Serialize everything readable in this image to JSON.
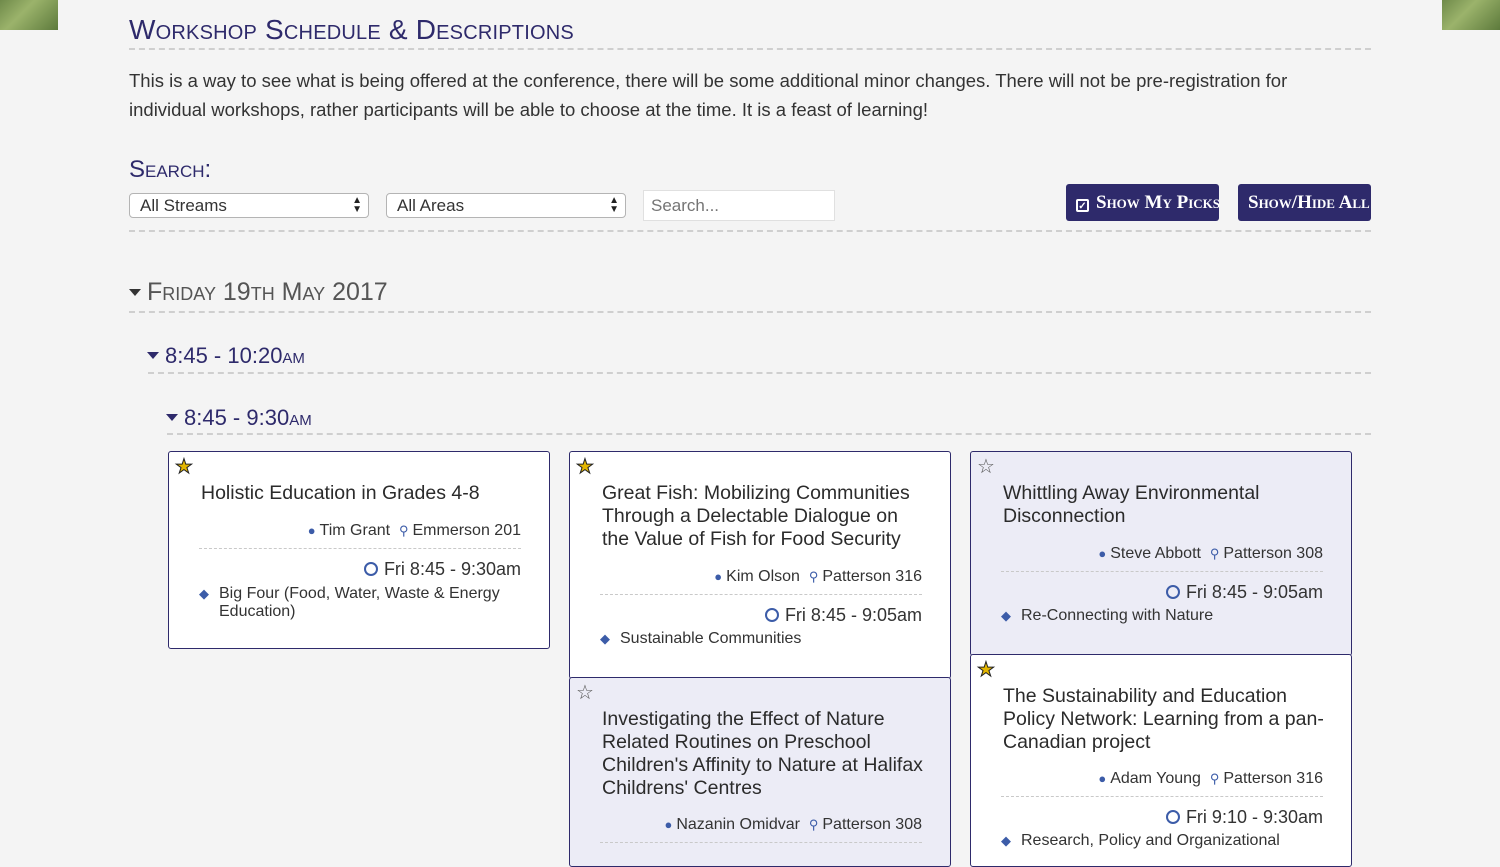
{
  "page": {
    "title": "Workshop Schedule & Descriptions",
    "intro": "This is a way to see what is being offered at the conference, there will be some additional minor changes. There will not be pre-registration for individual workshops, rather participants will be able to choose at the time. It is a feast of learning!"
  },
  "search": {
    "label": "Search:",
    "streams_selected": "All Streams",
    "areas_selected": "All Areas",
    "placeholder": "Search...",
    "show_picks_label": "Show My Picks",
    "show_hide_all_label": "Show/Hide All"
  },
  "schedule": {
    "day": "Friday 19th May 2017",
    "block": "8:45 - 10:20am",
    "slot": "8:45 - 9:30am"
  },
  "workshops": [
    {
      "title": "Holistic Education in Grades 4-8",
      "presenter": "Tim Grant",
      "room": "Emmerson 201",
      "time": "Fri 8:45 - 9:30am",
      "stream": "Big Four (Food, Water, Waste & Energy Education)",
      "picked": true
    },
    {
      "title": "Great Fish: Mobilizing Communities Through a Delectable Dialogue on the Value of Fish for Food Security",
      "presenter": "Kim Olson",
      "room": "Patterson 316",
      "time": "Fri 8:45 - 9:05am",
      "stream": "Sustainable Communities",
      "picked": true
    },
    {
      "title": "Whittling Away Environmental Disconnection",
      "presenter": "Steve Abbott",
      "room": "Patterson 308",
      "time": "Fri 8:45 - 9:05am",
      "stream": "Re-Connecting with Nature",
      "picked": false
    },
    {
      "title": "Investigating the Effect of Nature Related Routines on Preschool Children's Affinity to Nature at Halifax Childrens' Centres",
      "presenter": "Nazanin Omidvar",
      "room": "Patterson 308",
      "picked": false
    },
    {
      "title": "The Sustainability and Education Policy Network: Learning from a pan-Canadian project",
      "presenter": "Adam Young",
      "room": "Patterson 316",
      "time": "Fri 9:10 - 9:30am",
      "stream": "Research, Policy and Organizational",
      "picked": true
    }
  ]
}
